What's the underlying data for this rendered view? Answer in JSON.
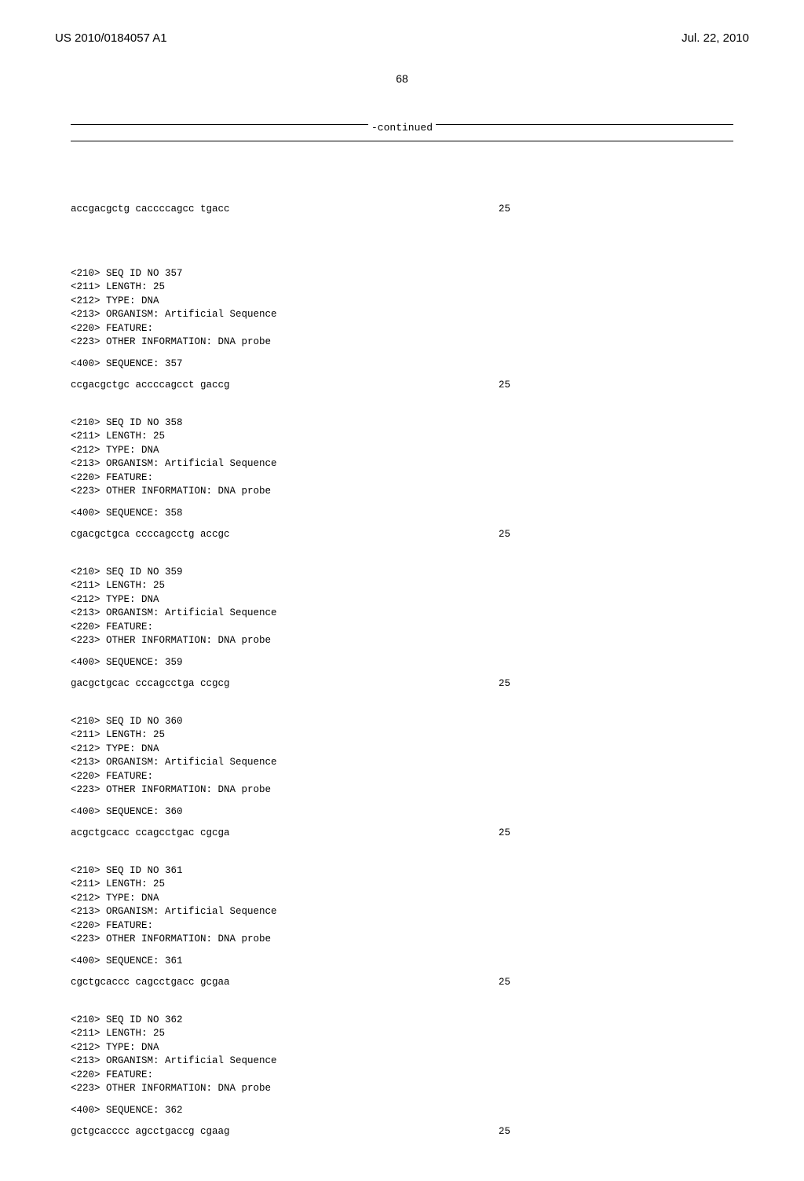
{
  "header": {
    "pub_no": "US 2010/0184057 A1",
    "date": "Jul. 22, 2010"
  },
  "page_number": "68",
  "continued_label": "-continued",
  "pre_sequence": {
    "sequence": "accgacgctg caccccagcc tgacc",
    "len": "25"
  },
  "blocks": [
    {
      "meta": [
        "<210> SEQ ID NO 357",
        "<211> LENGTH: 25",
        "<212> TYPE: DNA",
        "<213> ORGANISM: Artificial Sequence",
        "<220> FEATURE:",
        "<223> OTHER INFORMATION: DNA probe"
      ],
      "seq_label": "<400> SEQUENCE: 357",
      "sequence": "ccgacgctgc accccagcct gaccg",
      "len": "25"
    },
    {
      "meta": [
        "<210> SEQ ID NO 358",
        "<211> LENGTH: 25",
        "<212> TYPE: DNA",
        "<213> ORGANISM: Artificial Sequence",
        "<220> FEATURE:",
        "<223> OTHER INFORMATION: DNA probe"
      ],
      "seq_label": "<400> SEQUENCE: 358",
      "sequence": "cgacgctgca ccccagcctg accgc",
      "len": "25"
    },
    {
      "meta": [
        "<210> SEQ ID NO 359",
        "<211> LENGTH: 25",
        "<212> TYPE: DNA",
        "<213> ORGANISM: Artificial Sequence",
        "<220> FEATURE:",
        "<223> OTHER INFORMATION: DNA probe"
      ],
      "seq_label": "<400> SEQUENCE: 359",
      "sequence": "gacgctgcac cccagcctga ccgcg",
      "len": "25"
    },
    {
      "meta": [
        "<210> SEQ ID NO 360",
        "<211> LENGTH: 25",
        "<212> TYPE: DNA",
        "<213> ORGANISM: Artificial Sequence",
        "<220> FEATURE:",
        "<223> OTHER INFORMATION: DNA probe"
      ],
      "seq_label": "<400> SEQUENCE: 360",
      "sequence": "acgctgcacc ccagcctgac cgcga",
      "len": "25"
    },
    {
      "meta": [
        "<210> SEQ ID NO 361",
        "<211> LENGTH: 25",
        "<212> TYPE: DNA",
        "<213> ORGANISM: Artificial Sequence",
        "<220> FEATURE:",
        "<223> OTHER INFORMATION: DNA probe"
      ],
      "seq_label": "<400> SEQUENCE: 361",
      "sequence": "cgctgcaccc cagcctgacc gcgaa",
      "len": "25"
    },
    {
      "meta": [
        "<210> SEQ ID NO 362",
        "<211> LENGTH: 25",
        "<212> TYPE: DNA",
        "<213> ORGANISM: Artificial Sequence",
        "<220> FEATURE:",
        "<223> OTHER INFORMATION: DNA probe"
      ],
      "seq_label": "<400> SEQUENCE: 362",
      "sequence": "gctgcacccc agcctgaccg cgaag",
      "len": "25"
    }
  ]
}
